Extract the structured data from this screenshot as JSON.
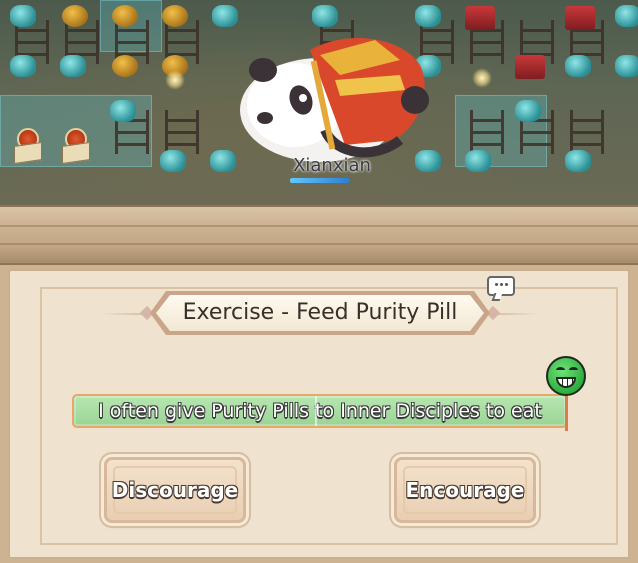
{
  "scene": {
    "character_name": "Xianxian"
  },
  "dialog": {
    "title": "Exercise - Feed Purity Pill",
    "statement": "I often give Purity Pills to Inner Disciples to eat",
    "reaction_icon": "grinning-face-icon",
    "chat_icon": "chat-bubble-icon",
    "buttons": {
      "discourage": "Discourage",
      "encourage": "Encourage"
    }
  },
  "colors": {
    "statement_bg": "#9ad494",
    "statement_border": "#e7a66a",
    "panel_bg": "#efe3cf",
    "reaction_face": "#2eae3f"
  }
}
